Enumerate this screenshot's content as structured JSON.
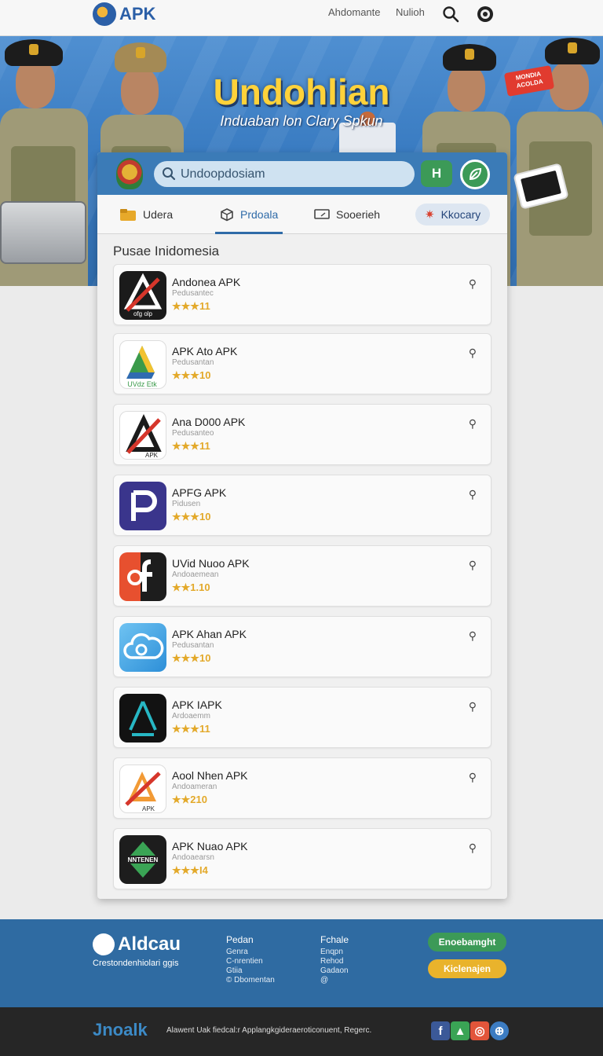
{
  "header": {
    "logo_text": "APK",
    "nav": [
      "Ahdomante",
      "Nulioh"
    ]
  },
  "hero": {
    "title": "Undohlian",
    "subtitle": "Induaban lon Clary Spkun",
    "sticker_text": "MONDIA ACOLDA"
  },
  "search": {
    "placeholder": "Undoopdosiam",
    "button_label": "H"
  },
  "tabs": [
    {
      "label": "Udera",
      "icon": "folder-icon"
    },
    {
      "label": "Prdoala",
      "icon": "cube-icon"
    },
    {
      "label": "Sooerieh",
      "icon": "monitor-icon"
    },
    {
      "label": "Kkocary",
      "icon": "star-icon"
    }
  ],
  "section_title": "Pusae Inidomesia",
  "apps": [
    {
      "name": "Andonea APK",
      "sub": "Pedusantec",
      "rating": "★★★11",
      "icon": "triangle-a-icon"
    },
    {
      "name": "APK Ato APK",
      "sub": "Pedusantan",
      "rating": "★★★10",
      "icon": "drive-a-icon"
    },
    {
      "name": "Ana D000 APK",
      "sub": "Pedusanteo",
      "rating": "★★★11",
      "icon": "crossed-a-icon"
    },
    {
      "name": "APFG APK",
      "sub": "Pidusen",
      "rating": "★★★10",
      "icon": "p-letter-icon"
    },
    {
      "name": "UVid Nuoo APK",
      "sub": "Andoaemean",
      "rating": "★★1.10",
      "icon": "f-letter-icon"
    },
    {
      "name": "APK Ahan APK",
      "sub": "Pedusantan",
      "rating": "★★★10",
      "icon": "cloud-icon"
    },
    {
      "name": "APK IAPK",
      "sub": "Ardoaemm",
      "rating": "★★★11",
      "icon": "dark-a-icon"
    },
    {
      "name": "Aool Nhen APK",
      "sub": "Andoameran",
      "rating": "★★210",
      "icon": "orange-a-icon"
    },
    {
      "name": "APK Nuao APK",
      "sub": "Andoaearsn",
      "rating": "★★★I4",
      "icon": "arrows-icon"
    }
  ],
  "footer": {
    "logo_text": "Aldcau",
    "tagline": "Crestondenhiolari ggis",
    "col1": {
      "heading": "Pedan",
      "items": [
        "Genra",
        "C-nrentien",
        "Gtiia",
        "© Dbomentan"
      ]
    },
    "col2": {
      "heading": "Fchale",
      "items": [
        "Enqpn",
        "Rehod",
        "Gadaon",
        "@"
      ]
    },
    "btn_primary": "Enoebamght",
    "btn_secondary": "Kiclenajen",
    "bottom_logo": "Jnoalk",
    "copyright": "Alawent Uak fiedcal:r Applangkgideraeroticonuent, Regerc."
  },
  "colors": {
    "accent_blue": "#2f6ba8",
    "green": "#3c9a57",
    "star": "#e3a92a",
    "yellow_title": "#ffd23a"
  }
}
